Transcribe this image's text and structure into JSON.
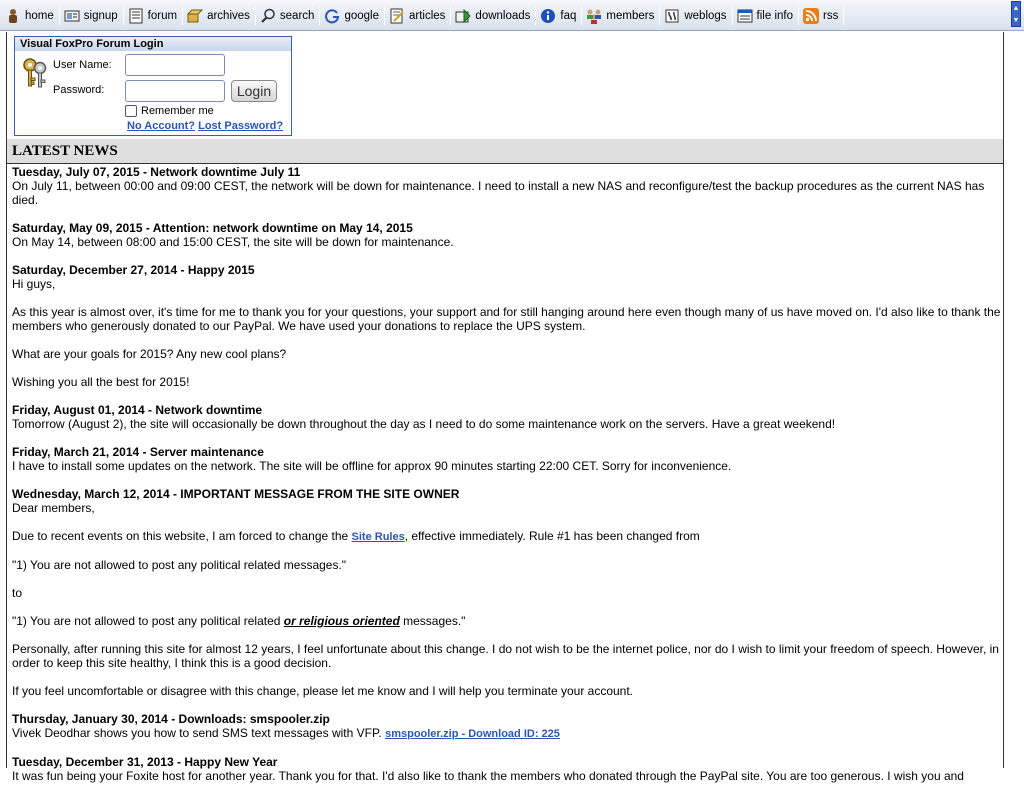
{
  "nav": {
    "items": [
      {
        "label": "home",
        "icon": "home-icon"
      },
      {
        "label": "signup",
        "icon": "signup-icon"
      },
      {
        "label": "forum",
        "icon": "forum-icon"
      },
      {
        "label": "archives",
        "icon": "archives-icon"
      },
      {
        "label": "search",
        "icon": "search-icon"
      },
      {
        "label": "google",
        "icon": "google-icon"
      },
      {
        "label": "articles",
        "icon": "articles-icon"
      },
      {
        "label": "downloads",
        "icon": "downloads-icon"
      },
      {
        "label": "faq",
        "icon": "faq-icon"
      },
      {
        "label": "members",
        "icon": "members-icon"
      },
      {
        "label": "weblogs",
        "icon": "weblogs-icon"
      },
      {
        "label": "file info",
        "icon": "file-info-icon"
      },
      {
        "label": "rss",
        "icon": "rss-icon"
      }
    ]
  },
  "login": {
    "title": "Visual FoxPro Forum Login",
    "username_label": "User Name:",
    "password_label": "Password:",
    "username_value": "",
    "password_value": "",
    "button_label": "Login",
    "remember_label": "Remember me",
    "no_account_link": "No Account?",
    "lost_password_link": "Lost Password?"
  },
  "news": {
    "header": "LATEST NEWS",
    "items": [
      {
        "title": "Tuesday, July 07, 2015 - Network downtime July 11",
        "p1": "On July 11, between 00:00 and 09:00 CEST, the network will be down for maintenance. I need to install a new NAS and reconfigure/test the backup procedures as the current NAS has died."
      },
      {
        "title": "Saturday, May 09, 2015 - Attention: network downtime on May 14, 2015",
        "p1": "On May 14, between 08:00 and 15:00 CEST, the site will be down for maintenance."
      },
      {
        "title": "Saturday, December 27, 2014 - Happy 2015",
        "p1": "Hi guys,",
        "p2": "As this year is almost over, it's time for me to thank you for your questions, your support and for still hanging around here even though many of us have moved on. I'd also like to thank the members who generously donated to our PayPal. We have used your donations to replace the UPS system.",
        "p3": "What are your goals for 2015? Any new cool plans?",
        "p4": "Wishing you all the best for 2015!"
      },
      {
        "title": "Friday, August 01, 2014 - Network downtime",
        "p1": "Tomorrow (August 2), the site will occasionally be down throughout the day as I need to do some maintenance work on the servers. Have a great weekend!"
      },
      {
        "title": "Friday, March 21, 2014 - Server maintenance",
        "p1": "I have to install some updates on the network. The site will be offline for approx 90 minutes starting 22:00 CET. Sorry for inconvenience."
      },
      {
        "title": "Wednesday, March 12, 2014 - IMPORTANT MESSAGE FROM THE SITE OWNER",
        "p1": "Dear members,",
        "p2_before": "Due to recent events on this website, I am forced to change the ",
        "p2_link": "Site Rules",
        "p2_after": ", effective immediately. Rule #1 has been changed from",
        "p3": "\"1) You are not allowed to post any political related messages.\"",
        "p4": "to",
        "p5_before": "\"1) You are not allowed to post any political related ",
        "p5_emph": "or religious oriented",
        "p5_after": " messages.\"",
        "p6": "Personally, after running this site for almost 12 years, I feel unfortunate about this change. I do not wish to be the internet police, nor do I wish to limit your freedom of speech. However, in order to keep this site healthy, I think this is a good decision.",
        "p7": "If you feel uncomfortable or disagree with this change, please let me know and I will help you terminate your account."
      },
      {
        "title": "Thursday, January 30, 2014 - Downloads: smspooler.zip",
        "p1_before": "Vivek Deodhar shows you how to send SMS text messages with VFP. ",
        "p1_link": "smspooler.zip - Download ID: 225"
      },
      {
        "title": "Tuesday, December 31, 2013 - Happy New Year",
        "p1": "It was fun being your Foxite host for another year. Thank you for that. I'd also like to thank the members who donated through the PayPal site. You are too generous. I wish you and"
      }
    ]
  }
}
